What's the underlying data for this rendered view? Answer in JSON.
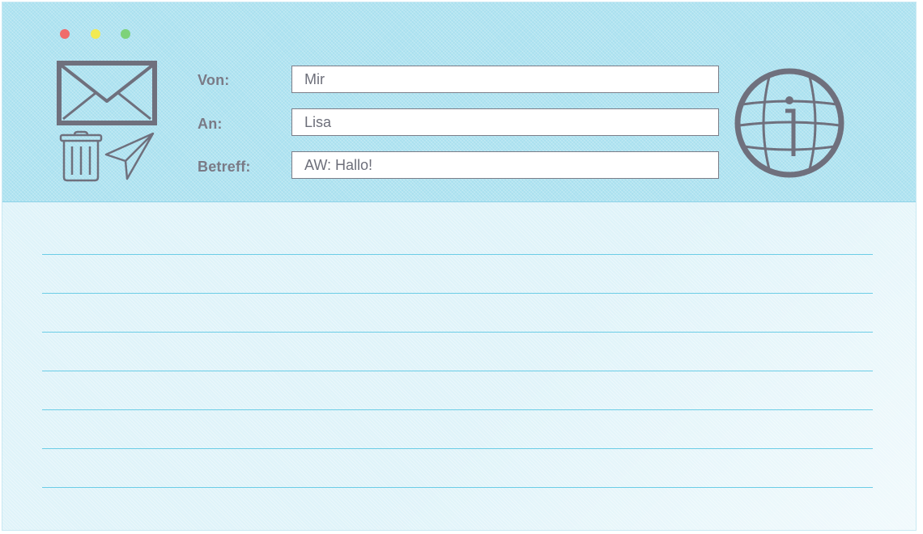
{
  "window": {
    "controls": [
      {
        "name": "close",
        "color": "#ef6b6b"
      },
      {
        "name": "minimize",
        "color": "#f2ea53"
      },
      {
        "name": "zoom",
        "color": "#7ed27a"
      }
    ]
  },
  "form": {
    "from_label": "Von:",
    "from_value": "Mir",
    "to_label": "An:",
    "to_value": "Lisa",
    "subject_label": "Betreff:",
    "subject_value": "AW: Hallo!"
  },
  "icons": {
    "mail": "envelope-icon",
    "delete": "trash-icon",
    "send": "paper-plane-icon",
    "info": "globe-info-icon",
    "stroke_color": "#6f707d"
  },
  "message": {
    "line_count": 7,
    "line_color": "#6ccde6"
  }
}
